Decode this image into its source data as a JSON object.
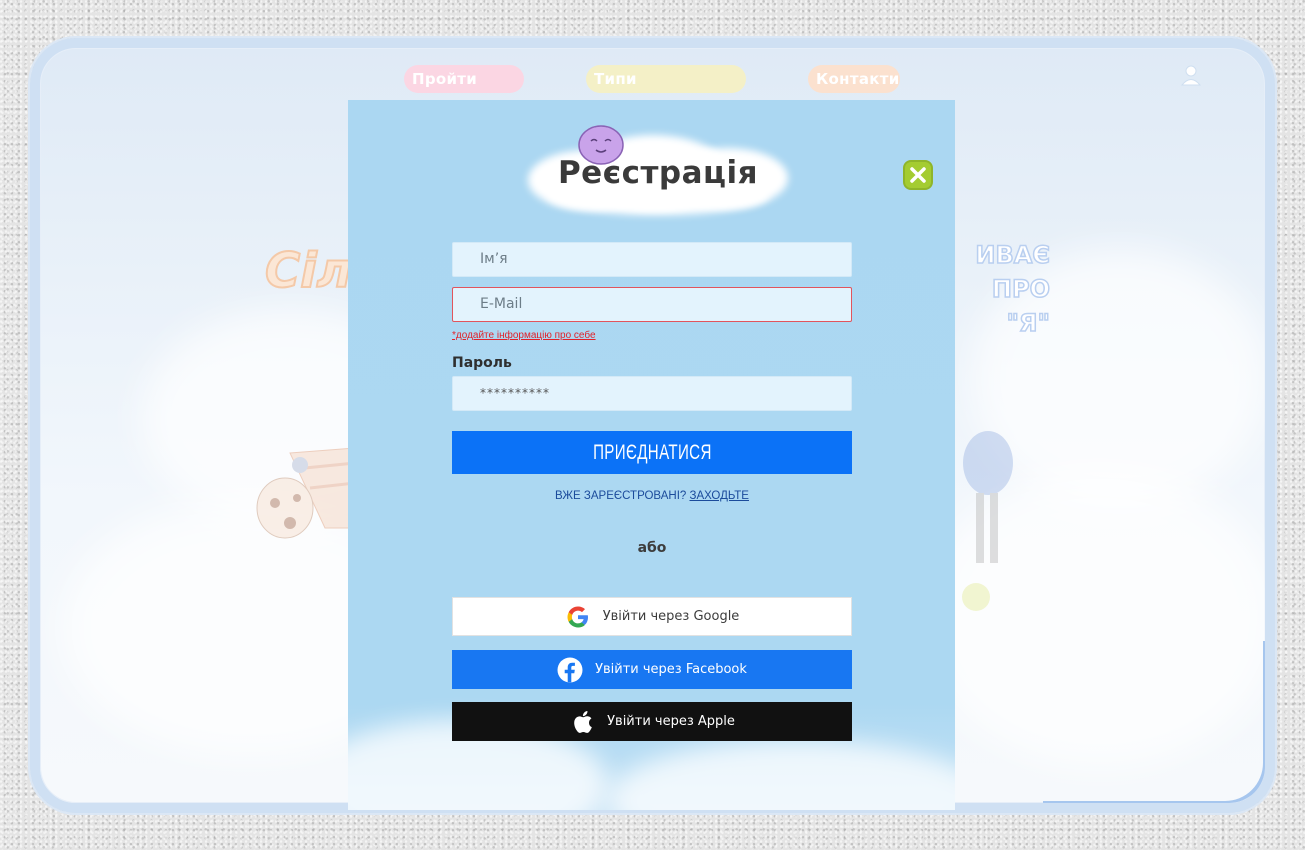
{
  "nav": {
    "take_test": "Пройти тест",
    "personality_types": "Типи особистості",
    "contacts": "Контакти"
  },
  "background": {
    "left_word": "Сіл",
    "right_word_lines": [
      "ИВАЄ",
      "ПРО",
      "\"Я\""
    ]
  },
  "modal": {
    "title": "Реєстрація",
    "name_placeholder": "Ім’я",
    "email_placeholder": "E-Mail",
    "error_message": "*додайте інформацію про себе",
    "password_label": "Пароль",
    "password_value": "**********",
    "submit_label": "ПРИЄДНАТИСЯ",
    "already_registered": "ВЖЕ ЗАРЕЄСТРОВАНІ?",
    "login_link": "ЗАХОДЬТЕ",
    "or_text": "або",
    "social": {
      "google": "Увійти через Google",
      "facebook": "Увійти через Facebook",
      "apple": "Увійти через Apple"
    }
  },
  "icons": {
    "user": "user-icon",
    "close": "close-icon",
    "google": "google-icon",
    "facebook": "facebook-icon",
    "apple": "apple-icon",
    "mascot": "mascot-icon"
  },
  "colors": {
    "modal_bg": "#abd7f2",
    "submit": "#0b72f7",
    "facebook": "#1877f2",
    "apple": "#111111",
    "close": "#a4cc31",
    "error": "#e0222a"
  }
}
